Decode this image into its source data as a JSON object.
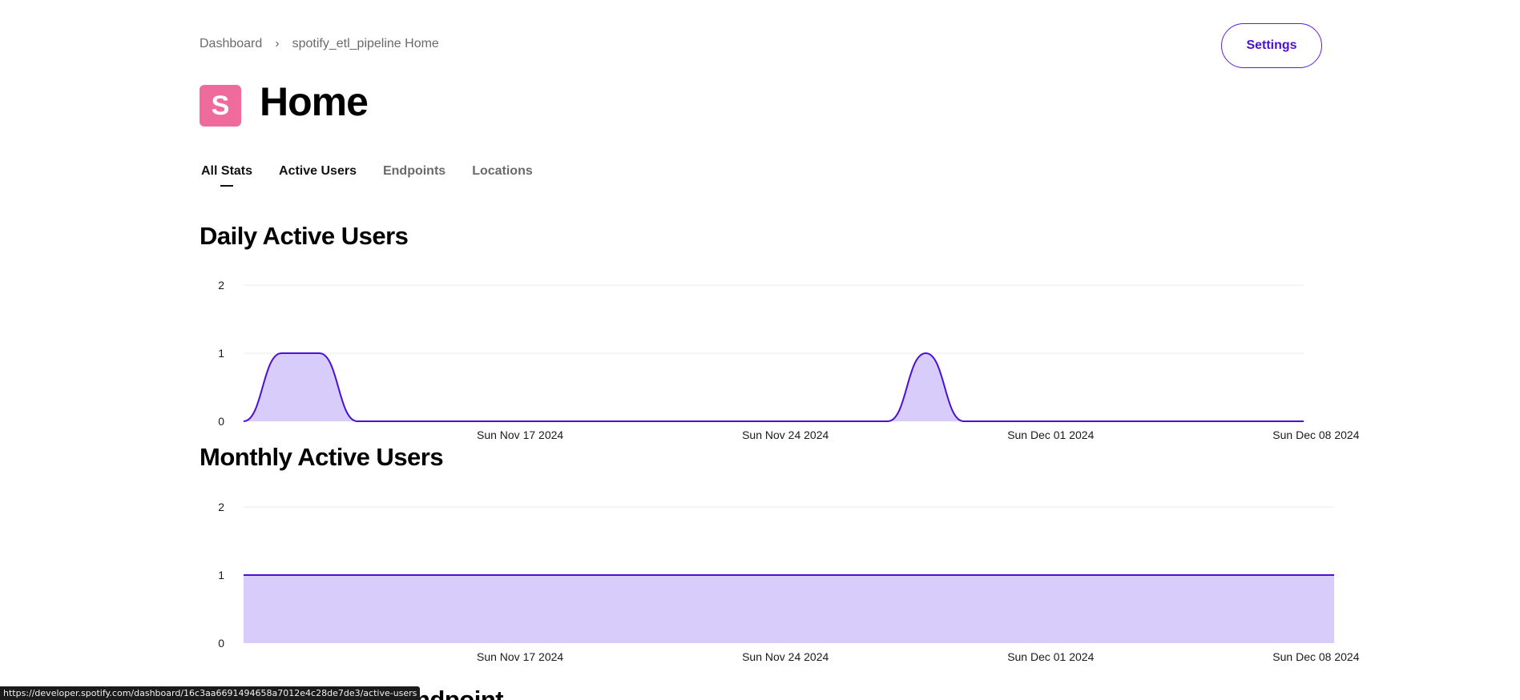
{
  "breadcrumb": {
    "root": "Dashboard",
    "separator": "›",
    "current": "spotify_etl_pipeline Home"
  },
  "header": {
    "app_icon_letter": "S",
    "title": "Home",
    "settings_label": "Settings"
  },
  "tabs": [
    {
      "label": "All Stats",
      "active": true
    },
    {
      "label": "Active Users",
      "active": false
    },
    {
      "label": "Endpoints",
      "active": false
    },
    {
      "label": "Locations",
      "active": false
    }
  ],
  "sections": {
    "daily_title": "Daily Active Users",
    "monthly_title": "Monthly Active Users",
    "next_title_partial": "ndpoint"
  },
  "status_bar_url": "https://developer.spotify.com/dashboard/16c3aa6691494658a7012e4c28de7de3/active-users",
  "colors": {
    "line": "#4a10d8",
    "fill": "#d8ccfb",
    "grid": "#ececec",
    "accent": "#5a1de2",
    "app_icon": "#ef6b9c"
  },
  "chart_data": [
    {
      "type": "area",
      "title": "Daily Active Users",
      "x": [
        "2024-11-10",
        "2024-11-11",
        "2024-11-12",
        "2024-11-13",
        "2024-11-14",
        "2024-11-15",
        "2024-11-16",
        "2024-11-17",
        "2024-11-18",
        "2024-11-19",
        "2024-11-20",
        "2024-11-21",
        "2024-11-22",
        "2024-11-23",
        "2024-11-24",
        "2024-11-25",
        "2024-11-26",
        "2024-11-27",
        "2024-11-28",
        "2024-11-29",
        "2024-11-30",
        "2024-12-01",
        "2024-12-02",
        "2024-12-03",
        "2024-12-04",
        "2024-12-05",
        "2024-12-06",
        "2024-12-07",
        "2024-12-08",
        "2024-12-09"
      ],
      "values": [
        0,
        1,
        1,
        0,
        0,
        0,
        0,
        0,
        0,
        0,
        0,
        0,
        0,
        0,
        0,
        0,
        0,
        0,
        1,
        0,
        0,
        0,
        0,
        0,
        0,
        0,
        0,
        0,
        0,
        0
      ],
      "x_tick_labels": [
        "Sun Nov 17 2024",
        "Sun Nov 24 2024",
        "Sun Dec 01 2024",
        "Sun Dec 08 2024"
      ],
      "y_ticks": [
        0,
        1,
        2
      ],
      "ylim": [
        0,
        2
      ],
      "grid": true
    },
    {
      "type": "area",
      "title": "Monthly Active Users",
      "x": [
        "2024-11-10",
        "2024-12-10"
      ],
      "values": [
        1,
        1
      ],
      "x_tick_labels": [
        "Sun Nov 17 2024",
        "Sun Nov 24 2024",
        "Sun Dec 01 2024",
        "Sun Dec 08 2024"
      ],
      "y_ticks": [
        0,
        1,
        2
      ],
      "ylim": [
        0,
        2
      ],
      "grid": true
    }
  ]
}
